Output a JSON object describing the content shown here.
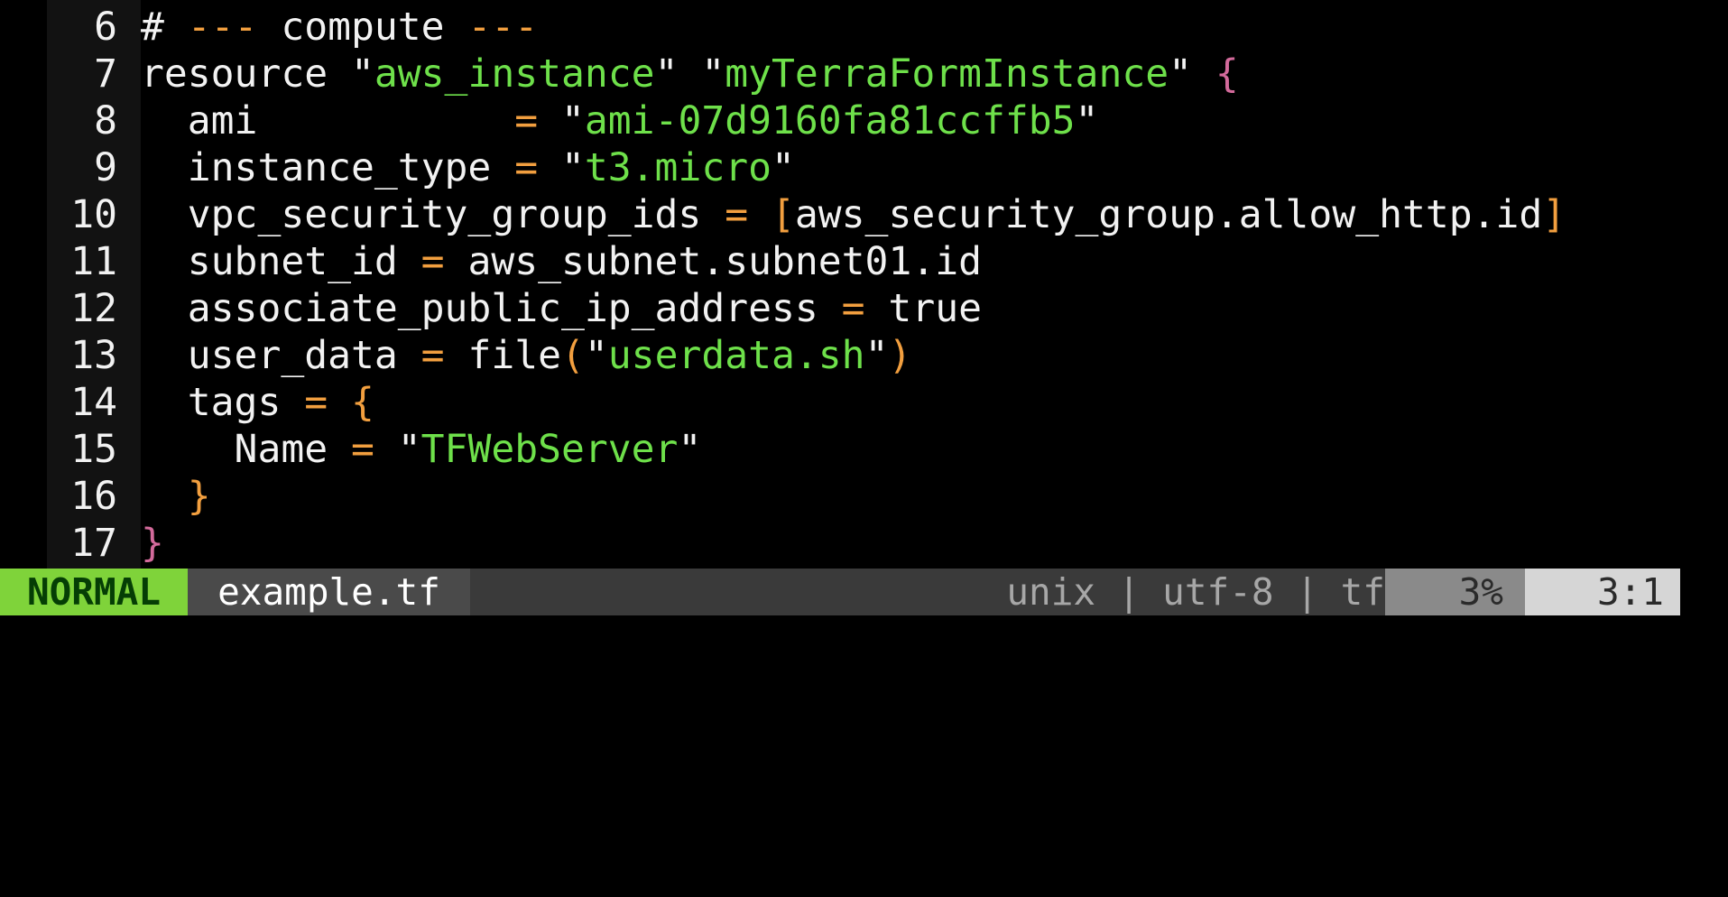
{
  "editor": {
    "lines": [
      {
        "num": "6",
        "tokens": [
          [
            "plain",
            "# "
          ],
          [
            "op",
            "---"
          ],
          [
            "plain",
            " compute "
          ],
          [
            "op",
            "---"
          ]
        ]
      },
      {
        "num": "7",
        "tokens": [
          [
            "plain",
            "resource \""
          ],
          [
            "str",
            "aws_instance"
          ],
          [
            "plain",
            "\" \""
          ],
          [
            "str",
            "myTerraFormInstance"
          ],
          [
            "plain",
            "\" "
          ],
          [
            "brace",
            "{"
          ]
        ]
      },
      {
        "num": "8",
        "tokens": [
          [
            "plain",
            "  ami           "
          ],
          [
            "op",
            "="
          ],
          [
            "plain",
            " \""
          ],
          [
            "str",
            "ami-07d9160fa81ccffb5"
          ],
          [
            "plain",
            "\""
          ]
        ]
      },
      {
        "num": "9",
        "tokens": [
          [
            "plain",
            "  instance_type "
          ],
          [
            "op",
            "="
          ],
          [
            "plain",
            " \""
          ],
          [
            "str",
            "t3.micro"
          ],
          [
            "plain",
            "\""
          ]
        ]
      },
      {
        "num": "10",
        "tokens": [
          [
            "plain",
            "  vpc_security_group_ids "
          ],
          [
            "op",
            "="
          ],
          [
            "plain",
            " "
          ],
          [
            "op",
            "["
          ],
          [
            "plain",
            "aws_security_group.allow_http.id"
          ],
          [
            "op",
            "]"
          ]
        ]
      },
      {
        "num": "11",
        "tokens": [
          [
            "plain",
            "  subnet_id "
          ],
          [
            "op",
            "="
          ],
          [
            "plain",
            " aws_subnet.subnet01.id"
          ]
        ]
      },
      {
        "num": "12",
        "tokens": [
          [
            "plain",
            "  associate_public_ip_address "
          ],
          [
            "op",
            "="
          ],
          [
            "plain",
            " true"
          ]
        ]
      },
      {
        "num": "13",
        "tokens": [
          [
            "plain",
            "  user_data "
          ],
          [
            "op",
            "="
          ],
          [
            "plain",
            " file"
          ],
          [
            "op",
            "("
          ],
          [
            "plain",
            "\""
          ],
          [
            "str",
            "userdata.sh"
          ],
          [
            "plain",
            "\""
          ],
          [
            "op",
            ")"
          ]
        ]
      },
      {
        "num": "14",
        "tokens": [
          [
            "plain",
            "  tags "
          ],
          [
            "op",
            "="
          ],
          [
            "plain",
            " "
          ],
          [
            "op",
            "{"
          ]
        ]
      },
      {
        "num": "15",
        "tokens": [
          [
            "plain",
            "    Name "
          ],
          [
            "op",
            "="
          ],
          [
            "plain",
            " \""
          ],
          [
            "str",
            "TFWebServer"
          ],
          [
            "plain",
            "\""
          ]
        ]
      },
      {
        "num": "16",
        "tokens": [
          [
            "plain",
            "  "
          ],
          [
            "op",
            "}"
          ]
        ]
      },
      {
        "num": "17",
        "tokens": [
          [
            "brace",
            "}"
          ]
        ]
      }
    ]
  },
  "statusline": {
    "mode": "NORMAL",
    "filename": "example.tf",
    "fileinfo": "unix | utf-8 | tf",
    "percent": "3%",
    "position": "3:1"
  },
  "colors": {
    "background": "#000000",
    "gutter": "#121212",
    "text": "#f2f2f2",
    "operator": "#f29f3f",
    "string": "#6ee04a",
    "brace": "#d36a9b",
    "mode_bg": "#7fd33a",
    "mode_fg": "#053e05"
  }
}
